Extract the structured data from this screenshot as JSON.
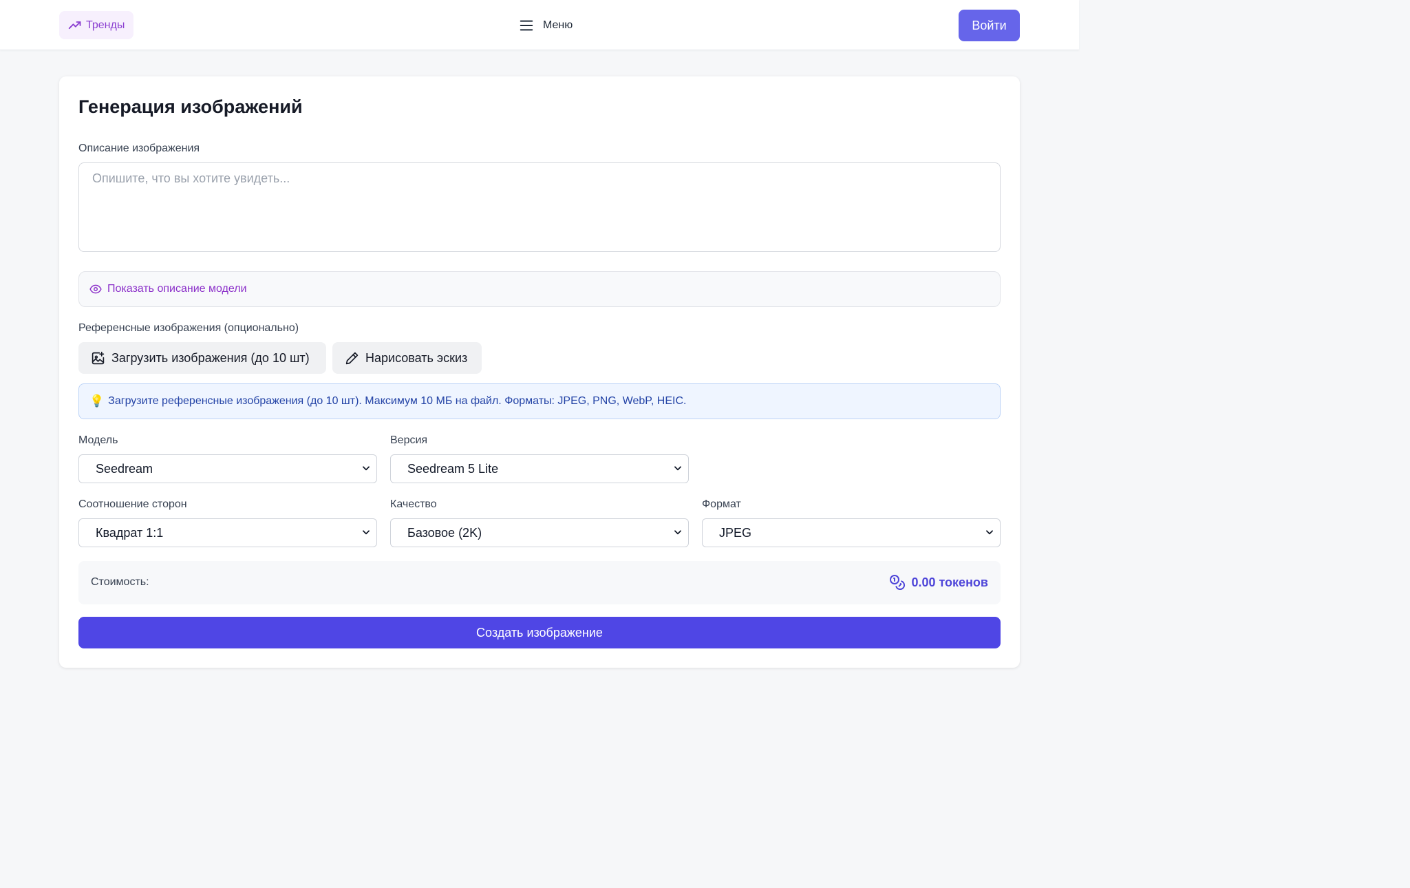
{
  "header": {
    "trends_label": "Тренды",
    "menu_label": "Меню",
    "login_label": "Войти"
  },
  "form": {
    "title": "Генерация изображений",
    "description_label": "Описание изображения",
    "description_placeholder": "Опишите, что вы хотите увидеть...",
    "description_value": "",
    "show_model_description": "Показать описание модели",
    "references_label": "Референсные изображения (опционально)",
    "upload_button": "Загрузить изображения (до 10 шт)",
    "sketch_button": "Нарисовать эскиз",
    "info_emoji": "💡",
    "info_text": "Загрузите референсные изображения (до 10 шт). Максимум 10 МБ на файл. Форматы: JPEG, PNG, WebP, HEIC.",
    "model_label": "Модель",
    "model_value": "Seedream",
    "version_label": "Версия",
    "version_value": "Seedream 5 Lite",
    "aspect_label": "Соотношение сторон",
    "aspect_value": "Квадрат 1:1",
    "quality_label": "Качество",
    "quality_value": "Базовое (2K)",
    "format_label": "Формат",
    "format_value": "JPEG",
    "cost_label": "Стоимость:",
    "cost_value": "0.00 токенов",
    "create_button": "Создать изображение"
  },
  "colors": {
    "accent": "#4f46e5",
    "login": "#6665ea",
    "trends": "#8b3fd1",
    "info_bg": "#eff5ff",
    "info_text": "#2343a6"
  },
  "icons": {
    "trends": "trending-up-icon",
    "menu": "hamburger-icon",
    "eye": "eye-icon",
    "upload": "image-plus-icon",
    "sketch": "pencil-icon",
    "coins": "coins-icon",
    "chevron": "chevron-down-icon"
  }
}
